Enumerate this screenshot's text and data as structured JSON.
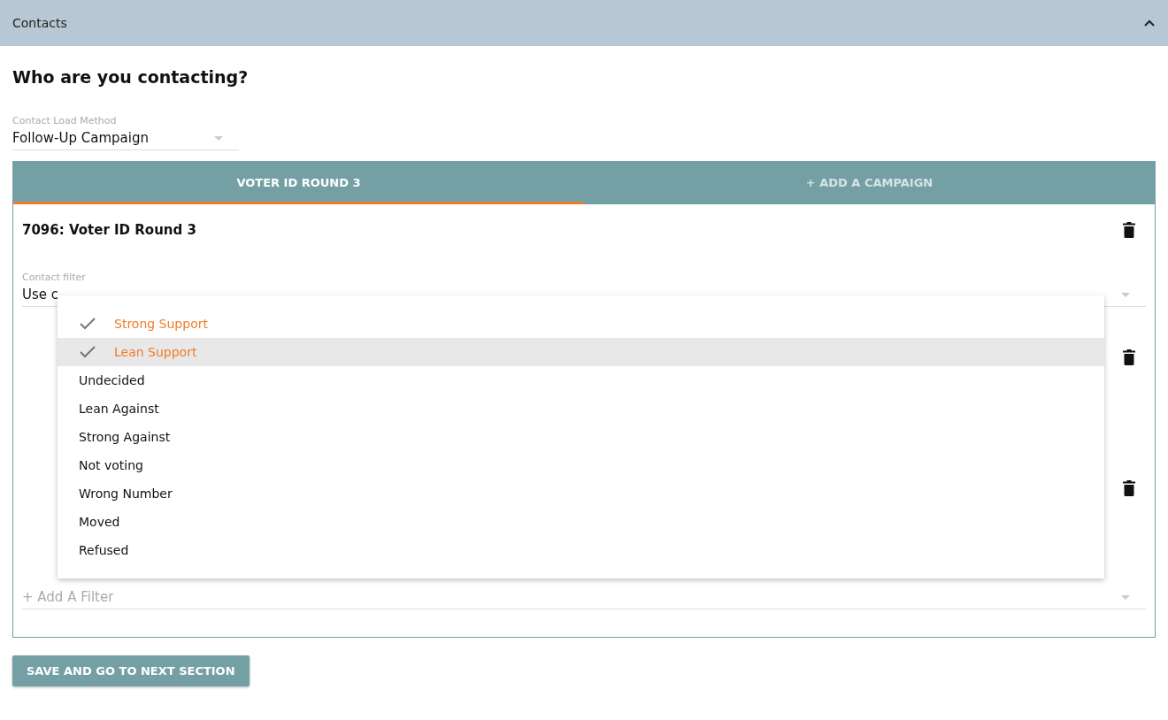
{
  "panel": {
    "title": "Contacts",
    "expanded": true
  },
  "heading": "Who are you contacting?",
  "load_method": {
    "label": "Contact Load Method",
    "value": "Follow-Up Campaign"
  },
  "tabs": [
    {
      "label": "VOTER ID ROUND 3",
      "selected": true
    },
    {
      "label": "+ ADD A CAMPAIGN",
      "selected": false
    }
  ],
  "campaign": {
    "title": "7096: Voter ID Round 3",
    "deletable": true,
    "contact_filter": {
      "label": "Contact filter",
      "value": "Use c"
    },
    "filter_rows": [
      {
        "deletable": true
      },
      {
        "deletable": true
      }
    ],
    "add_filter": {
      "placeholder": "+ Add A Filter"
    }
  },
  "menu": {
    "options": [
      {
        "label": "Strong Support",
        "checked": true,
        "hovered": false
      },
      {
        "label": "Lean Support",
        "checked": true,
        "hovered": true
      },
      {
        "label": "Undecided",
        "checked": false,
        "hovered": false
      },
      {
        "label": "Lean Against",
        "checked": false,
        "hovered": false
      },
      {
        "label": "Strong Against",
        "checked": false,
        "hovered": false
      },
      {
        "label": "Not voting",
        "checked": false,
        "hovered": false
      },
      {
        "label": "Wrong Number",
        "checked": false,
        "hovered": false
      },
      {
        "label": "Moved",
        "checked": false,
        "hovered": false
      },
      {
        "label": "Refused",
        "checked": false,
        "hovered": false
      }
    ]
  },
  "save_button": "SAVE AND GO TO NEXT SECTION"
}
